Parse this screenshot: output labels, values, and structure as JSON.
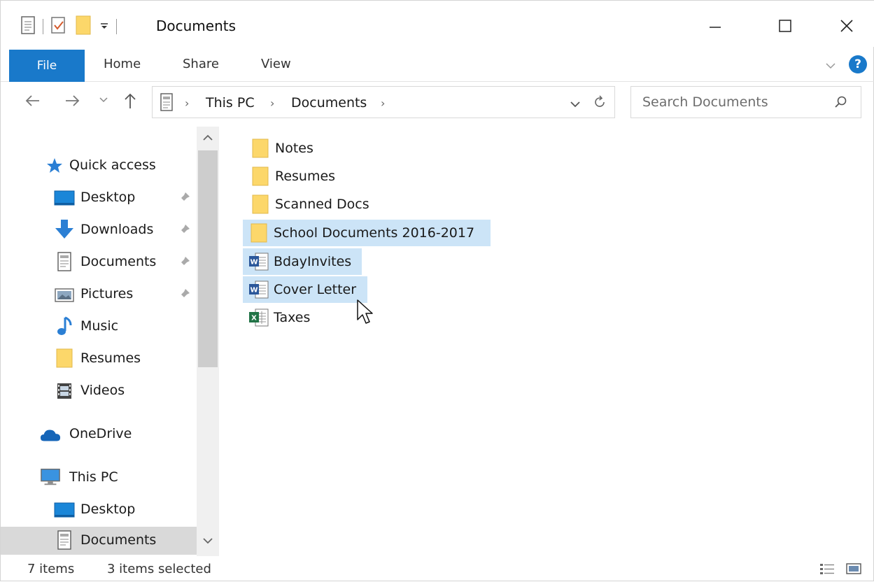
{
  "window": {
    "title": "Documents",
    "controls": {
      "minimize": "minimize",
      "maximize": "maximize",
      "close": "close"
    }
  },
  "ribbon": {
    "tabs": [
      {
        "label": "File",
        "active": true
      },
      {
        "label": "Home"
      },
      {
        "label": "Share"
      },
      {
        "label": "View"
      }
    ],
    "help_label": "?"
  },
  "nav": {
    "breadcrumb": [
      "This PC",
      "Documents"
    ],
    "search_placeholder": "Search Documents"
  },
  "sidebar": {
    "items": [
      {
        "label": "Quick access",
        "icon": "star-icon"
      },
      {
        "label": "Desktop",
        "icon": "desktop-icon",
        "pinned": true
      },
      {
        "label": "Downloads",
        "icon": "download-arrow-icon",
        "pinned": true
      },
      {
        "label": "Documents",
        "icon": "document-icon",
        "pinned": true
      },
      {
        "label": "Pictures",
        "icon": "pictures-icon",
        "pinned": true
      },
      {
        "label": "Music",
        "icon": "music-note-icon"
      },
      {
        "label": "Resumes",
        "icon": "folder-icon"
      },
      {
        "label": "Videos",
        "icon": "film-icon"
      },
      {
        "label": "OneDrive",
        "icon": "cloud-icon"
      },
      {
        "label": "This PC",
        "icon": "computer-icon"
      },
      {
        "label": "Desktop",
        "icon": "desktop-icon"
      },
      {
        "label": "Documents",
        "icon": "document-icon",
        "selected": true
      }
    ]
  },
  "files": [
    {
      "name": "Notes",
      "type": "folder",
      "selected": false
    },
    {
      "name": "Resumes",
      "type": "folder",
      "selected": false
    },
    {
      "name": "Scanned Docs",
      "type": "folder",
      "selected": false
    },
    {
      "name": "School Documents 2016-2017",
      "type": "folder",
      "selected": true
    },
    {
      "name": "BdayInvites",
      "type": "word",
      "selected": true
    },
    {
      "name": "Cover Letter",
      "type": "word",
      "selected": true
    },
    {
      "name": "Taxes",
      "type": "excel",
      "selected": false
    }
  ],
  "status": {
    "item_count": "7 items",
    "selected_count": "3 items selected"
  },
  "colors": {
    "accent": "#1979ca",
    "selection": "#cce4f7",
    "folder": "#fcd76a"
  }
}
